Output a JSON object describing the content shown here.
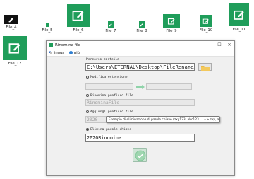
{
  "desktop": {
    "files": [
      {
        "name": "File_4"
      },
      {
        "name": "File_5"
      },
      {
        "name": "File_6"
      },
      {
        "name": "File_7"
      },
      {
        "name": "File_8"
      },
      {
        "name": "File_9"
      },
      {
        "name": "File_10"
      },
      {
        "name": "File_11"
      },
      {
        "name": "File_12"
      }
    ]
  },
  "window": {
    "title": "Rinomina file",
    "controls": {
      "minimize": "—",
      "maximize": "☐",
      "close": "✕"
    },
    "menu": {
      "language": "lingua",
      "more": "più"
    }
  },
  "form": {
    "folder_path_label": "Percorso cartella",
    "folder_path_value": "C:\\Users\\ETERNAL\\Desktop\\FileRenameAssis",
    "modify_extension_label": "Modifica estensione",
    "rename_prefix_label": "Rinomina prefisso file",
    "rename_prefix_placeholder": "RinominaFile",
    "add_prefix_label": "Aggiungi prefisso file",
    "add_prefix_value": "2020",
    "delete_keyword_label": "Elimina parole chiave",
    "delete_keyword_value": "2020Rinomina",
    "tooltip": "Esempio di eliminazione di parole chiave (zxy123, abc123 ... => zxy, abc ...)"
  },
  "colors": {
    "accent": "#1f9d5a",
    "ok_button": "#cfe5d6",
    "arrow": "#8fd3a9"
  },
  "icons": {
    "file": "edit-square-icon",
    "folder": "folder-icon",
    "arrow": "arrow-right-icon",
    "ok": "checkmark-icon"
  }
}
